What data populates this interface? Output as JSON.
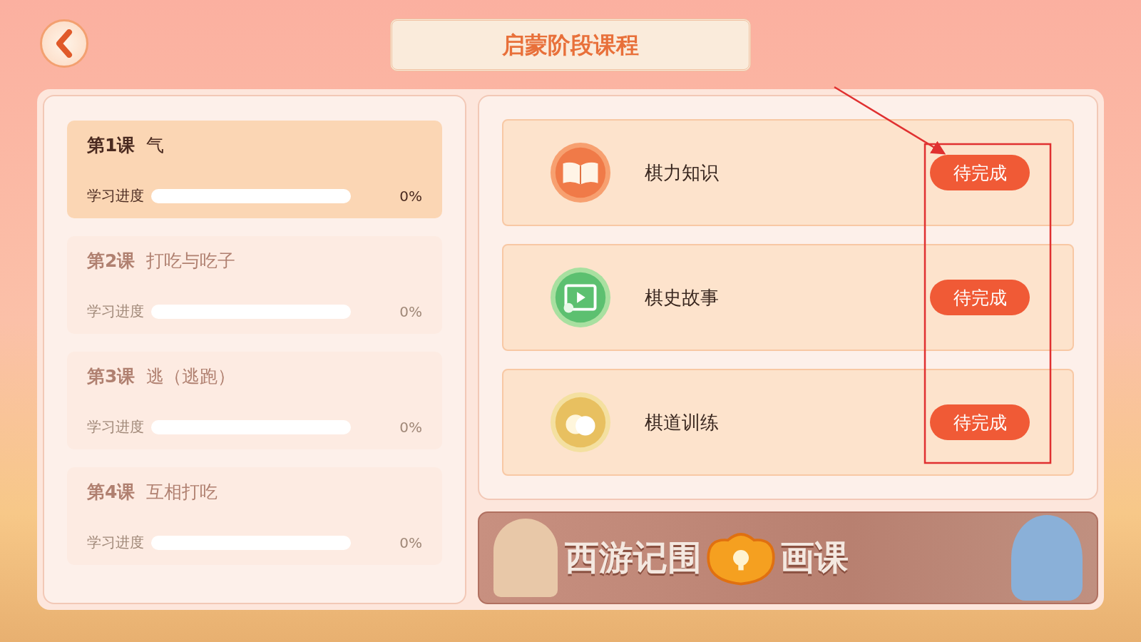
{
  "header": {
    "title": "启蒙阶段课程"
  },
  "lessons": [
    {
      "number": "第1课",
      "name": "气",
      "progress_label": "学习进度",
      "percent": "0%",
      "selected": true
    },
    {
      "number": "第2课",
      "name": "打吃与吃子",
      "progress_label": "学习进度",
      "percent": "0%",
      "selected": false
    },
    {
      "number": "第3课",
      "name": "逃（逃跑）",
      "progress_label": "学习进度",
      "percent": "0%",
      "selected": false
    },
    {
      "number": "第4课",
      "name": "互相打吃",
      "progress_label": "学习进度",
      "percent": "0%",
      "selected": false
    }
  ],
  "tasks": [
    {
      "kind": "book",
      "title": "棋力知识",
      "status": "待完成"
    },
    {
      "kind": "video",
      "title": "棋史故事",
      "status": "待完成"
    },
    {
      "kind": "stones",
      "title": "棋道训练",
      "status": "待完成"
    }
  ],
  "banner": {
    "title_left": "西游记围",
    "title_right": "画课",
    "locked": true
  }
}
